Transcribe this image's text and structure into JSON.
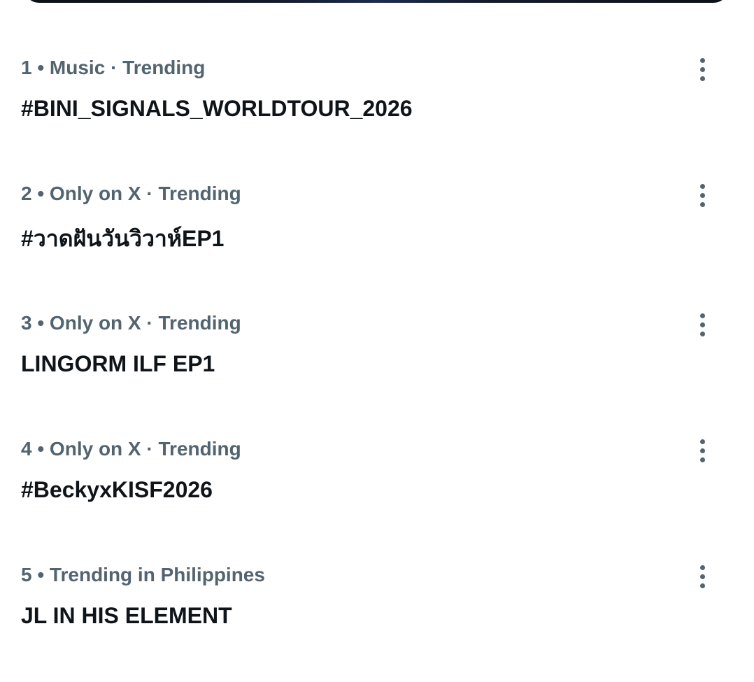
{
  "trends": [
    {
      "meta": "1 • Music · Trending",
      "name": "#BINI_SIGNALS_WORLDTOUR_2026"
    },
    {
      "meta": "2 • Only on X · Trending",
      "name": "#วาดฝันวันวิวาห์EP1"
    },
    {
      "meta": "3 • Only on X · Trending",
      "name": "LINGORM ILF EP1"
    },
    {
      "meta": "4 • Only on X · Trending",
      "name": "#BeckyxKISF2026"
    },
    {
      "meta": "5 • Trending in Philippines",
      "name": "JL IN HIS ELEMENT"
    }
  ],
  "icons": {
    "more": "more-vertical-icon"
  },
  "colors": {
    "meta_text": "#536471",
    "name_text": "#0f1419",
    "background": "#ffffff"
  }
}
